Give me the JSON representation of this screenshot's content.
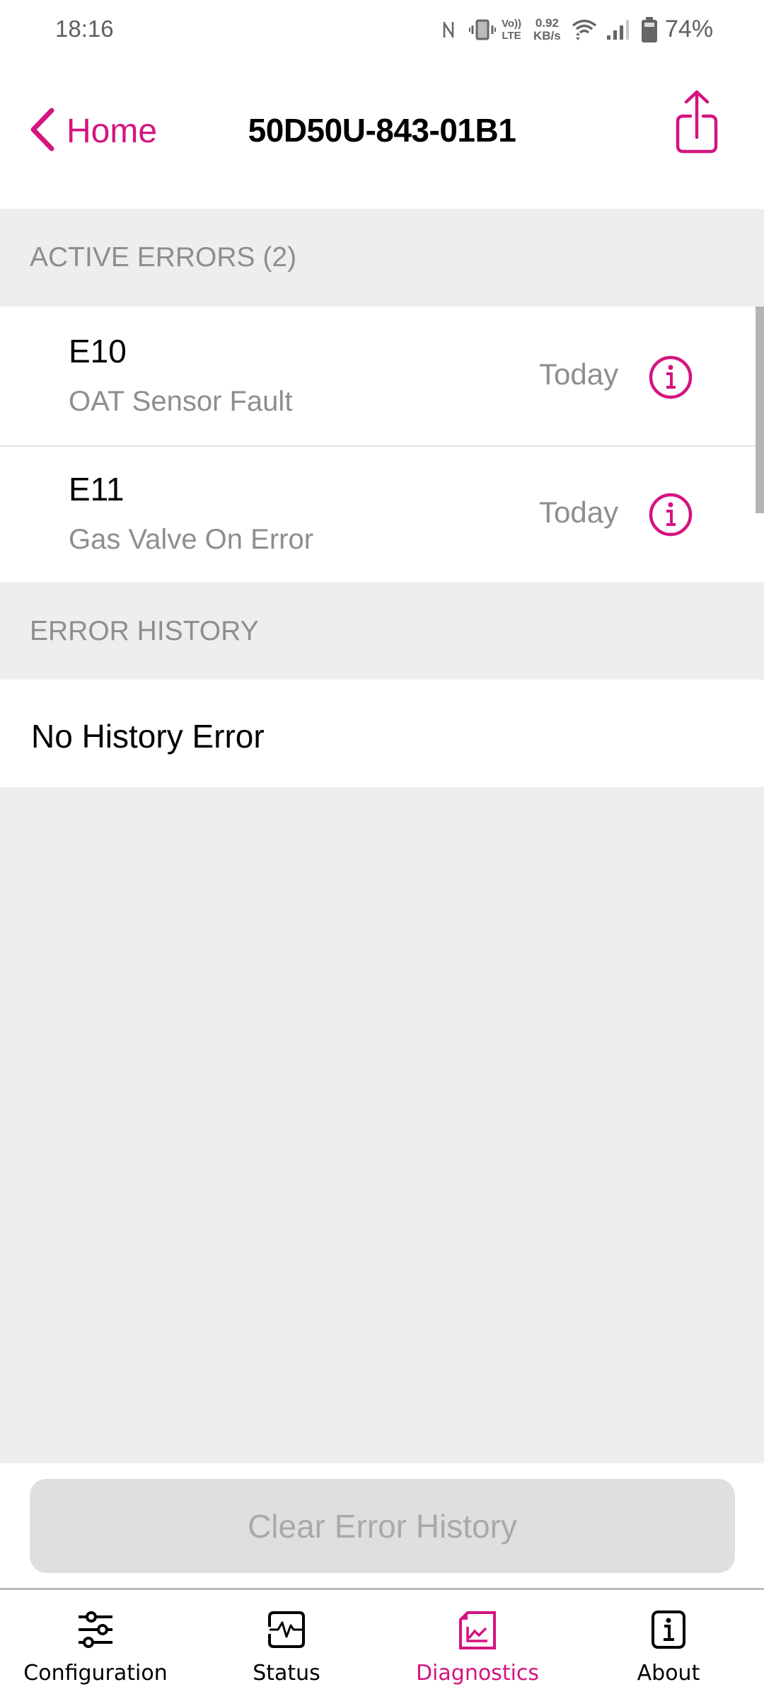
{
  "status_bar": {
    "time": "18:16",
    "icons": [
      "nfc-icon",
      "vibrate-icon",
      "volte-icon",
      "wifi-icon",
      "cell-signal-icon",
      "battery-icon"
    ],
    "volte_top": "Vo))",
    "volte_bottom": "LTE",
    "speed_value": "0.92",
    "speed_unit": "KB/s",
    "battery_percent": "74%"
  },
  "header": {
    "back_label": "Home",
    "title": "50D50U-843-01B1",
    "share_icon": "share-icon"
  },
  "colors": {
    "accent": "#d4147f",
    "section_bg": "#eeeeee",
    "secondary_text": "#8e8e8e"
  },
  "active_errors": {
    "header": "ACTIVE ERRORS (2)",
    "items": [
      {
        "code": "E10",
        "description": "OAT Sensor Fault",
        "date": "Today",
        "icon": "info-icon"
      },
      {
        "code": "E11",
        "description": "Gas Valve On Error",
        "date": "Today",
        "icon": "info-icon"
      }
    ]
  },
  "error_history": {
    "header": "ERROR HISTORY",
    "empty_text": "No History Error"
  },
  "actions": {
    "clear_label": "Clear Error History"
  },
  "tabs": [
    {
      "label": "Configuration",
      "icon": "sliders-icon",
      "active": false
    },
    {
      "label": "Status",
      "icon": "pulse-icon",
      "active": false
    },
    {
      "label": "Diagnostics",
      "icon": "chart-document-icon",
      "active": true
    },
    {
      "label": "About",
      "icon": "info-box-icon",
      "active": false
    }
  ]
}
